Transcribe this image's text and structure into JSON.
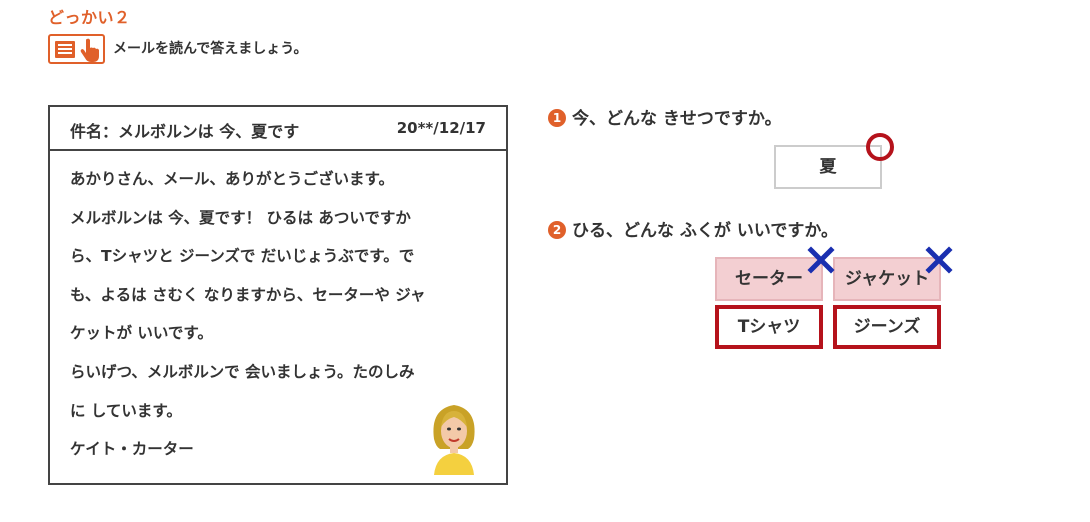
{
  "section": {
    "title": "どっかい２"
  },
  "instruction": {
    "text": "メールを読んで答えましょう。",
    "icon": "read-and-tap-icon"
  },
  "email": {
    "subject": "件名：メルボルンは 今、夏です",
    "date": "20**/12/17",
    "lines": [
      "あかりさん、メール、ありがとうございます。",
      "メルボルンは 今、夏です！ ひるは あついですか",
      "ら、Tシャツと ジーンズで だいじょうぶです。で",
      "も、よるは さむく なりますから、セーターや ジャ",
      "ケットが いいです。",
      "らいげつ、メルボルンで 会いましょう。たのしみ",
      "に しています。",
      "ケイト・カーター"
    ]
  },
  "questions": [
    {
      "number": "1",
      "text": "今、どんな きせつですか。",
      "answer": "夏"
    },
    {
      "number": "2",
      "text": "ひる、どんな ふくが いいですか。",
      "choices": [
        {
          "label": "セーター",
          "correct": false
        },
        {
          "label": "ジャケット",
          "correct": false
        },
        {
          "label": "Tシャツ",
          "correct": true
        },
        {
          "label": "ジーンズ",
          "correct": true
        }
      ]
    }
  ],
  "colors": {
    "accent": "#e0602a",
    "correct": "#b5121b",
    "wrong_mark": "#1a2fb0",
    "wrong_fill": "#f3cfd2"
  }
}
